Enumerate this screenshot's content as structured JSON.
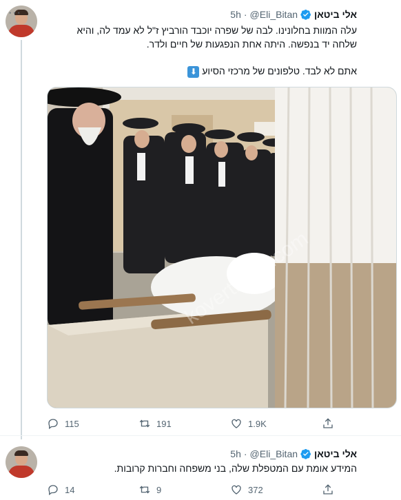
{
  "tweet1": {
    "display_name": "אלי ביטאן",
    "handle": "@Eli_Bitan",
    "dot": "·",
    "time": "5h",
    "line1": "עלה המוות בחלונינו. לבה של שפרה יוכבד הורביץ ז\"ל לא עמד לה, והיא",
    "line2": "שלחה יד בנפשה. היתה אחת הנפגעות של חיים ולדר.",
    "line3": "אתם לא לבד. טלפונים של מרכזי הסיוע",
    "watermark": "kovertiebel.com",
    "reply_count": "115",
    "retweet_count": "191",
    "like_count": "1.9K"
  },
  "tweet2": {
    "display_name": "אלי ביטאן",
    "handle": "@Eli_Bitan",
    "dot": "·",
    "time": "5h",
    "line1": "המידע אומת עם המטפלת שלה, בני משפחה וחברות קרובות.",
    "reply_count": "14",
    "retweet_count": "9",
    "like_count": "372"
  },
  "colors": {
    "verified": "#1d9bf0",
    "secondary_text": "#536471",
    "thread_line": "#cfd9de",
    "emoji_box": "#3b94d9"
  },
  "icons": [
    "verified-badge-icon",
    "more-icon",
    "down-arrow-emoji-icon",
    "reply-icon",
    "retweet-icon",
    "like-icon",
    "share-icon"
  ]
}
